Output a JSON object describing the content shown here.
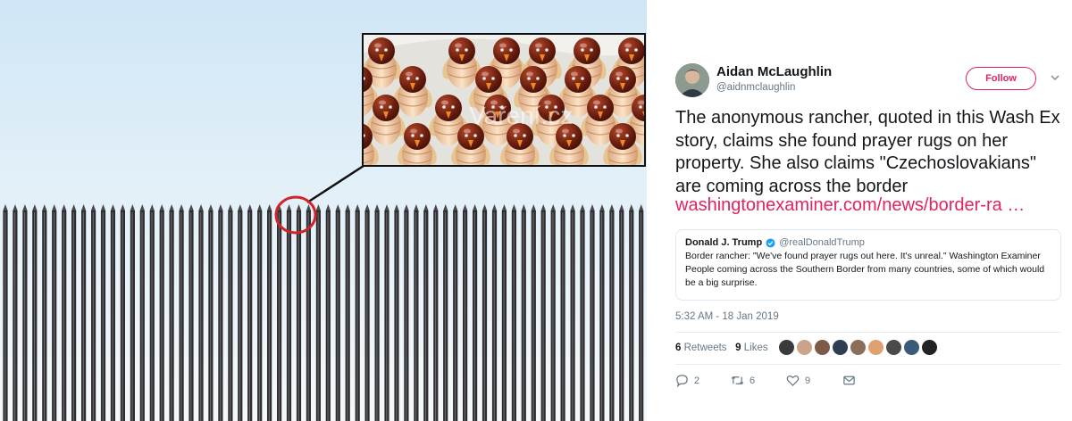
{
  "image": {
    "watermark": "Vaření.cz",
    "callout_color": "#d0252a",
    "sky_color": "#d6eaf7",
    "bar_color": "#2e2e30"
  },
  "tweet": {
    "author": {
      "display_name": "Aidan McLaughlin",
      "handle": "@aidnmclaughlin"
    },
    "follow_label": "Follow",
    "text": "The anonymous rancher, quoted in this Wash Ex story, claims she found prayer rugs on her property. She also claims \"Czechoslovakians\" are coming across the border",
    "link": "washingtonexaminer.com/news/border-ra …",
    "quoted": {
      "display_name": "Donald J. Trump",
      "handle": "@realDonaldTrump",
      "text": "Border rancher: \"We've found prayer rugs out here. It's unreal.\"  Washington Examiner People coming across the Southern Border from many countries, some of which would be a big surprise."
    },
    "timestamp": "5:32 AM - 18 Jan 2019",
    "stats": {
      "retweets_count": "6",
      "retweets_label": "Retweets",
      "likes_count": "9",
      "likes_label": "Likes"
    },
    "liker_avatar_colors": [
      "#3a3a3a",
      "#c9a48a",
      "#7c5b48",
      "#2c3e50",
      "#8a6e5a",
      "#e0a070",
      "#4a4a4a",
      "#3b5a7a",
      "#222222"
    ],
    "actions": {
      "reply_count": "2",
      "retweet_count": "6",
      "like_count": "9"
    },
    "accent_color": "#e0245e",
    "verified_color": "#1da1f2"
  }
}
